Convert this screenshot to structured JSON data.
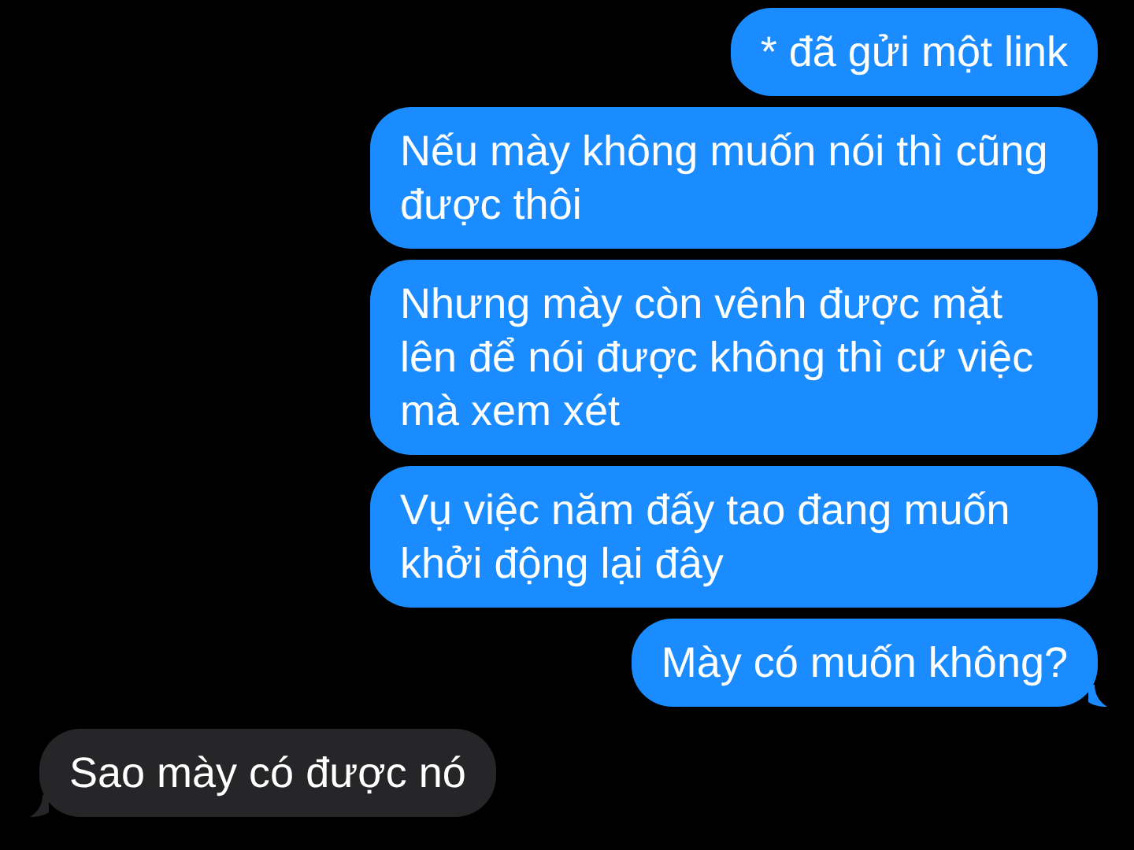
{
  "messages": [
    {
      "kind": "sent",
      "text": "* đã gửi một link",
      "tail": false
    },
    {
      "kind": "sent",
      "text": "Nếu mày không muốn nói thì cũng được thôi",
      "tail": false
    },
    {
      "kind": "sent",
      "text": "Nhưng mày còn vênh được mặt lên để nói được không thì cứ việc mà xem xét",
      "tail": false
    },
    {
      "kind": "sent",
      "text": "Vụ việc năm đấy tao đang muốn khởi động lại đây",
      "tail": false
    },
    {
      "kind": "sent",
      "text": "Mày có muốn không?",
      "tail": true
    },
    {
      "kind": "received",
      "text": "Sao mày có được nó",
      "tail": true
    }
  ]
}
